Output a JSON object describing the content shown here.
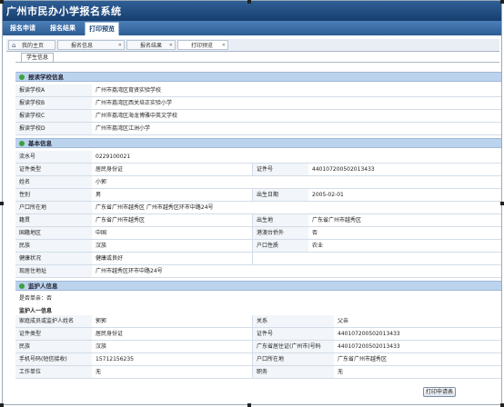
{
  "app": {
    "title": "广州市民办小学报名系统"
  },
  "menu": [
    {
      "label": "报名申请"
    },
    {
      "label": "报名结果"
    },
    {
      "label": "打印预览"
    }
  ],
  "tabs": [
    {
      "label": "我的主页"
    },
    {
      "label": "报名信息"
    },
    {
      "label": "报名结果"
    },
    {
      "label": "打印预览"
    }
  ],
  "subtab": "学生信息",
  "school_section": {
    "title": "报读学校信息",
    "rows": [
      {
        "label": "报读学校A",
        "value": "广州市荔湾区育贤实验学校"
      },
      {
        "label": "报读学校B",
        "value": "广州市荔湾区西关培正实验小学"
      },
      {
        "label": "报读学校C",
        "value": "广州市荔湾区海龙博雅中英文学校"
      },
      {
        "label": "报读学校D",
        "value": "广州市荔湾区江洲小学"
      }
    ]
  },
  "basic_section": {
    "title": "基本信息",
    "serial_label": "流水号",
    "serial_value": "0229100021",
    "id_type_label": "证件类型",
    "id_type_value": "居民身份证",
    "id_no_label": "证件号",
    "id_no_value": "440107200502013433",
    "name_label": "姓名",
    "name_value": "小郭",
    "gender_label": "性别",
    "gender_value": "男",
    "birth_label": "出生日期",
    "birth_value": "2005-02-01",
    "hukou_label": "户口所在地",
    "hukou_value": "广东省广州市越秀区 广州市越秀区环市中路24号",
    "origin_label": "籍贯",
    "origin_value": "广东省广州市越秀区",
    "birthplace_label": "出生地",
    "birthplace_value": "广东省广州市越秀区",
    "country_label": "国籍地区",
    "country_value": "中国",
    "hkmo_label": "港澳台侨外",
    "hkmo_value": "否",
    "ethnic_label": "民族",
    "ethnic_value": "汉族",
    "hukou_type_label": "户口性质",
    "hukou_type_value": "农业",
    "health_label": "健康状况",
    "health_value": "健康或良好",
    "address_label": "现居住地址",
    "address_value": "广州市越秀区环市中路24号"
  },
  "guardian_section": {
    "title": "监护人信息",
    "single_parent": "是否单亲：否",
    "guardian_one": "监护人一信息",
    "member_label": "家庭成员或监护人姓名",
    "member_value": "郭郭",
    "relation_label": "关系",
    "relation_value": "父亲",
    "g_id_type_label": "证件类型",
    "g_id_type_value": "居民身份证",
    "g_id_no_label": "证件号",
    "g_id_no_value": "440107200502013433",
    "g_ethnic_label": "民族",
    "g_ethnic_value": "汉族",
    "g_permit_label": "广东省居住证(广州市)号码",
    "g_permit_value": "440107200502013433",
    "phone_label": "手机号码(短信接收)",
    "phone_value": "15712156235",
    "g_hukou_label": "户口所在地",
    "g_hukou_value": "广东省广州市越秀区",
    "work_label": "工作单位",
    "work_value": "无",
    "duty_label": "职务",
    "duty_value": "无"
  },
  "print_button": "打印申请表",
  "colors": {
    "titlebar": "#1f4b80",
    "menubar": "#3c6da6",
    "section": "#bcd3ee"
  }
}
